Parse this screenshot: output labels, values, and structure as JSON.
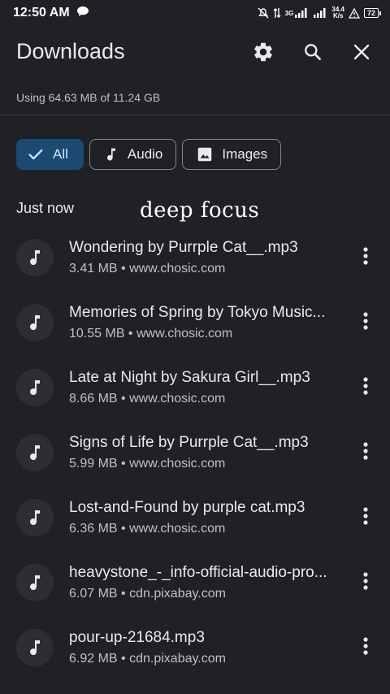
{
  "status": {
    "time": "12:50 AM",
    "network": "3G",
    "speed_top": "34.4",
    "speed_bottom": "K/s",
    "battery": "72"
  },
  "appbar": {
    "title": "Downloads",
    "icons": [
      "settings-icon",
      "search-icon",
      "close-icon"
    ]
  },
  "storage": {
    "usage_text": "Using 64.63 MB of 11.24 GB"
  },
  "filters": [
    {
      "label": "All",
      "selected": true,
      "icon": "check-icon"
    },
    {
      "label": "Audio",
      "selected": false,
      "icon": "music-note-icon"
    },
    {
      "label": "Images",
      "selected": false,
      "icon": "image-icon"
    }
  ],
  "section": {
    "label": "Just now"
  },
  "overlay": {
    "text": "deep focus"
  },
  "downloads": [
    {
      "title": "Wondering by Purrple Cat__.mp3",
      "size": "3.41 MB",
      "source": "www.chosic.com"
    },
    {
      "title": "Memories of Spring by Tokyo Music...",
      "size": "10.55 MB",
      "source": "www.chosic.com"
    },
    {
      "title": "Late at Night by Sakura Girl__.mp3",
      "size": "8.66 MB",
      "source": "www.chosic.com"
    },
    {
      "title": "Signs of Life by Purrple Cat__.mp3",
      "size": "5.99 MB",
      "source": "www.chosic.com"
    },
    {
      "title": "Lost-and-Found by purple cat.mp3",
      "size": "6.36 MB",
      "source": "www.chosic.com"
    },
    {
      "title": "heavystone_-_info-official-audio-pro...",
      "size": "6.07 MB",
      "source": "cdn.pixabay.com"
    },
    {
      "title": "pour-up-21684.mp3",
      "size": "6.92 MB",
      "source": "cdn.pixabay.com"
    }
  ],
  "separator": " • ",
  "colors": {
    "background": "#202124",
    "chip_selected_bg": "#1c4a73",
    "text_primary": "#e8eaed",
    "text_secondary": "#bdc1c6"
  }
}
